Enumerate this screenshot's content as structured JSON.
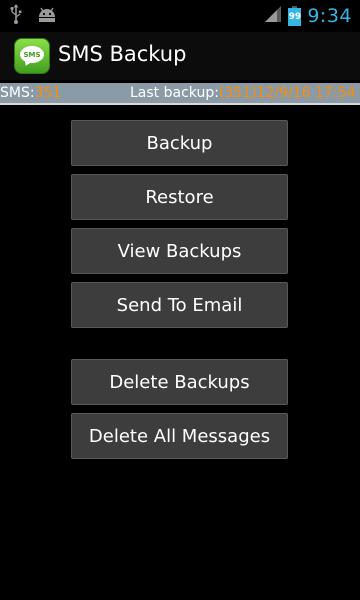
{
  "status_bar": {
    "time": "9:34",
    "battery_percent": "99",
    "battery_level": 0.99,
    "icons": [
      "usb-icon",
      "android-debug-icon",
      "signal-icon",
      "battery-icon"
    ]
  },
  "app": {
    "title": "SMS Backup",
    "icon_name": "sms-app-icon",
    "icon_text": "SMS"
  },
  "info_bar": {
    "sms_label": "SMS:",
    "sms_count": "351",
    "last_backup_label": "Last backup:",
    "last_backup_value": "(351)12/9/16 17:54"
  },
  "buttons": {
    "backup": "Backup",
    "restore": "Restore",
    "view_backups": "View Backups",
    "send_to_email": "Send To Email",
    "delete_backups": "Delete Backups",
    "delete_all_messages": "Delete All Messages"
  },
  "colors": {
    "status_time": "#33b5e5",
    "info_bar_bg": "#8a9aa6",
    "info_value": "#ff8c00",
    "button_bg": "#3d3d3d",
    "app_icon_green": "#5cbf2a"
  }
}
